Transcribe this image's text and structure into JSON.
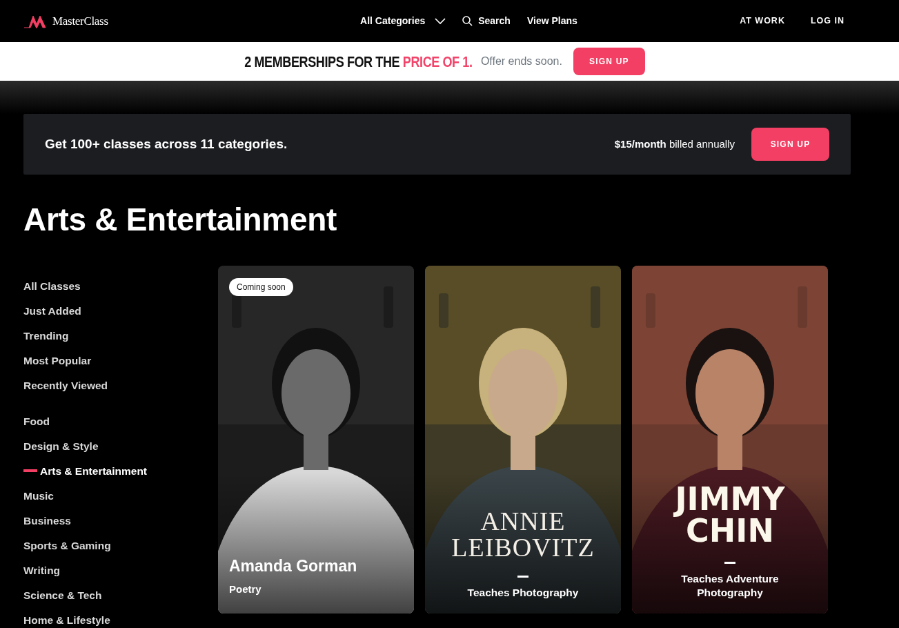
{
  "nav": {
    "logo": "MasterClass",
    "center": [
      {
        "kind": "dropdown",
        "label": "All Categories"
      },
      {
        "kind": "search",
        "label": "Search"
      },
      {
        "kind": "link",
        "label": "View Plans"
      }
    ],
    "right": [
      "AT WORK",
      "LOG IN"
    ]
  },
  "promo": {
    "headline": "2 MEMBERSHIPS FOR THE",
    "highlight": "PRICE OF 1.",
    "note": "Offer ends soon.",
    "button": "SIGN UP"
  },
  "banner": {
    "text": "Get 100+ classes across 11 categories.",
    "price": "**$15/month** billed annually",
    "button": "SIGN UP"
  },
  "heading": "Arts & Entertainment",
  "sidebar": {
    "groups": [
      [
        {
          "label": "All Classes",
          "selected": false
        },
        {
          "label": "Just Added",
          "selected": false
        },
        {
          "label": "Trending",
          "selected": false
        },
        {
          "label": "Most Popular",
          "selected": false
        },
        {
          "label": "Recently Viewed",
          "selected": false
        }
      ],
      [
        {
          "label": "Food",
          "selected": false
        },
        {
          "label": "Design & Style",
          "selected": false
        },
        {
          "label": "Arts & Entertainment",
          "selected": true
        },
        {
          "label": "Music",
          "selected": false
        },
        {
          "label": "Business",
          "selected": false
        },
        {
          "label": "Sports & Gaming",
          "selected": false
        },
        {
          "label": "Writing",
          "selected": false
        },
        {
          "label": "Science & Tech",
          "selected": false
        },
        {
          "label": "Home & Lifestyle",
          "selected": false
        }
      ]
    ]
  },
  "cards": [
    {
      "kind": "caption",
      "badge": "Coming soon",
      "name": "Amanda Gorman",
      "subtitle": "Poetry"
    },
    {
      "kind": "serif-title",
      "title_lines": [
        "ANNIE",
        "LEIBOVITZ"
      ],
      "subtitle": "Teaches Photography"
    },
    {
      "kind": "sans-title",
      "title_lines": [
        "JIMMY",
        "CHIN"
      ],
      "subtitle": "Teaches Adventure Photography"
    }
  ]
}
